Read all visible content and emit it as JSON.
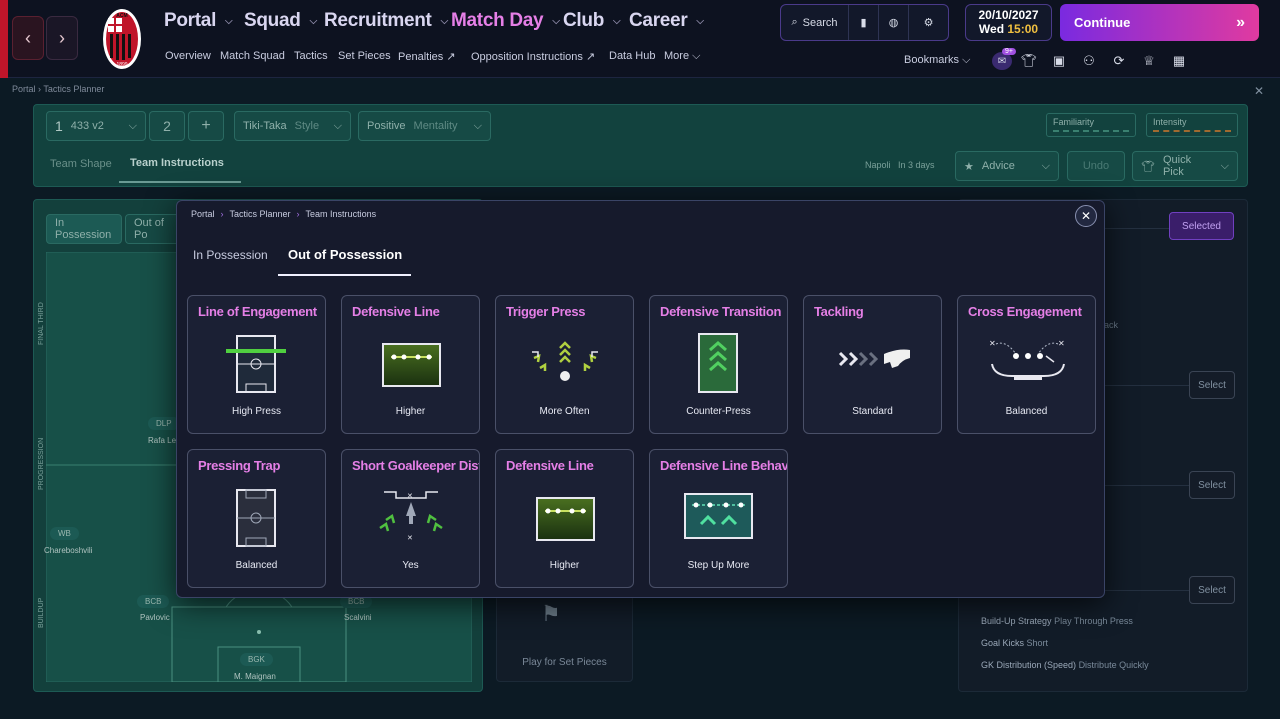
{
  "top": {
    "nav": [
      {
        "label": "Portal",
        "active": false
      },
      {
        "label": "Squad",
        "active": false
      },
      {
        "label": "Recruitment",
        "active": false
      },
      {
        "label": "Match Day",
        "active": true
      },
      {
        "label": "Club",
        "active": false
      },
      {
        "label": "Career",
        "active": false
      }
    ],
    "subnav": [
      "Overview",
      "Match Squad",
      "Tactics",
      "Set Pieces",
      "Penalties",
      "Opposition Instructions",
      "Data Hub",
      "More"
    ],
    "search_label": "Search",
    "date": "20/10/2027",
    "day": "Wed",
    "time": "15:00",
    "continue_label": "Continue",
    "bookmarks_label": "Bookmarks",
    "notif_badge": "9+",
    "crest_text": "ACM",
    "crest_year": "1899"
  },
  "background": {
    "crumb": [
      "Portal",
      "Tactics Planner"
    ],
    "tactic_num": "1",
    "formation": "433 v2",
    "tactic_num2": "2",
    "style_value": "Tiki-Taka",
    "style_label": "Style",
    "mentality_value": "Positive",
    "mentality_label": "Mentality",
    "familiarity_label": "Familiarity",
    "intensity_label": "Intensity",
    "tabs": [
      "Team Shape",
      "Team Instructions"
    ],
    "opponent": "Napoli",
    "opponent_when": "In 3 days",
    "advice_label": "Advice",
    "undo_label": "Undo",
    "quickpick_label": "Quick Pick",
    "pitch_tabs": [
      "In Possession",
      "Out of Po"
    ],
    "zones": [
      "FINAL THIRD",
      "PROGRESSION",
      "BUILDUP"
    ],
    "players": [
      {
        "pos": "DLP",
        "name": "Rafa Le"
      },
      {
        "pos": "WB",
        "name": "Chareboshvili"
      },
      {
        "pos": "BCB",
        "name": "Pavlovic"
      },
      {
        "pos": "BCB",
        "name": "Scalvini"
      },
      {
        "pos": "BGK",
        "name": "M. Maignan"
      }
    ],
    "set_pieces_label": "Play for Set Pieces",
    "selected_label": "Selected",
    "select_label": "Select",
    "right_frag1": "ttack",
    "right_frag2": "e",
    "summary": [
      {
        "k": "Build-Up Strategy",
        "v": "Play Through Press"
      },
      {
        "k": "Goal Kicks",
        "v": "Short"
      },
      {
        "k": "GK Distribution (Speed)",
        "v": "Distribute Quickly"
      }
    ]
  },
  "modal": {
    "crumb": [
      "Portal",
      "Tactics Planner",
      "Team Instructions"
    ],
    "tabs": [
      "In Possession",
      "Out of Possession"
    ],
    "active_tab": 1,
    "cards": [
      {
        "title": "Line of Engagement",
        "value": "High Press",
        "icon": "line-of-engagement-icon"
      },
      {
        "title": "Defensive Line",
        "value": "Higher",
        "icon": "defensive-line-icon"
      },
      {
        "title": "Trigger Press",
        "value": "More Often",
        "icon": "trigger-press-icon"
      },
      {
        "title": "Defensive Transition",
        "value": "Counter-Press",
        "icon": "defensive-transition-icon"
      },
      {
        "title": "Tackling",
        "value": "Standard",
        "icon": "tackling-icon"
      },
      {
        "title": "Cross Engagement",
        "value": "Balanced",
        "icon": "cross-engagement-icon"
      },
      {
        "title": "Pressing Trap",
        "value": "Balanced",
        "icon": "pressing-trap-icon"
      },
      {
        "title": "Short Goalkeeper Distr",
        "value": "Yes",
        "icon": "short-gk-distribution-icon"
      },
      {
        "title": "Defensive Line",
        "value": "Higher",
        "icon": "defensive-line-icon"
      },
      {
        "title": "Defensive Line Behavio",
        "value": "Step Up More",
        "icon": "defensive-line-behaviour-icon"
      }
    ]
  },
  "colors": {
    "accent": "#e57fe6",
    "pitch": "#13403c",
    "continue_from": "#7a2ae0",
    "continue_to": "#e03aa0"
  }
}
